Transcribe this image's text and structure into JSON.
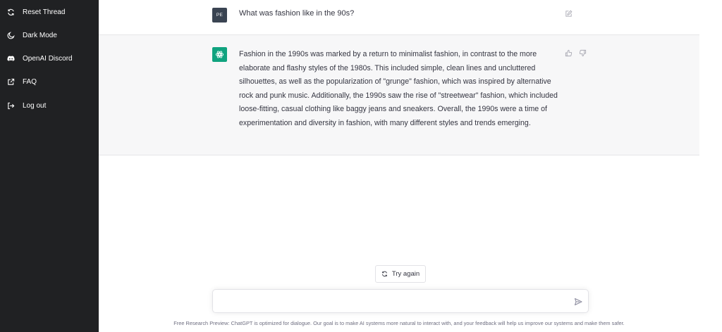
{
  "sidebar": {
    "items": [
      {
        "label": "Reset Thread",
        "icon": "refresh-icon"
      },
      {
        "label": "Dark Mode",
        "icon": "moon-icon"
      },
      {
        "label": "OpenAI Discord",
        "icon": "discord-icon"
      },
      {
        "label": "FAQ",
        "icon": "external-link-icon"
      },
      {
        "label": "Log out",
        "icon": "logout-icon"
      }
    ]
  },
  "conversation": {
    "question": {
      "avatar_initials": "PE",
      "text": "What was fashion like in the 90s?"
    },
    "answer": {
      "text": "Fashion in the 1990s was marked by a return to minimalist fashion, in contrast to the more elaborate and flashy styles of the 1980s. This included simple, clean lines and uncluttered silhouettes, as well as the popularization of \"grunge\" fashion, which was inspired by alternative rock and punk music. Additionally, the 1990s saw the rise of \"streetwear\" fashion, which included loose-fitting, casual clothing like baggy jeans and sneakers. Overall, the 1990s were a time of experimentation and diversity in fashion, with many different styles and trends emerging."
    }
  },
  "controls": {
    "try_again_label": "Try again",
    "input_value": "",
    "input_placeholder": ""
  },
  "footer": {
    "text": "Free Research Preview: ChatGPT is optimized for dialogue. Our goal is to make AI systems more natural to interact with, and your feedback will help us improve our systems and make them safer."
  },
  "colors": {
    "sidebar_bg": "#202123",
    "answer_bg": "#f7f7f8",
    "brand_green": "#10a37f",
    "avatar_bg": "#3a4452"
  }
}
